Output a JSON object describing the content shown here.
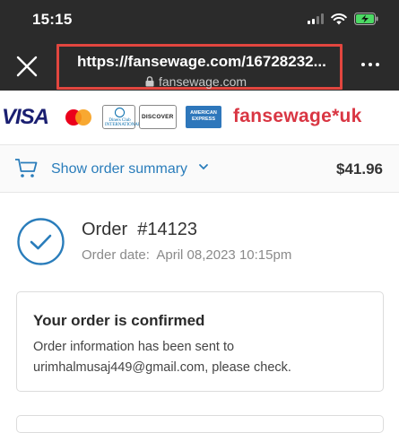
{
  "status_bar": {
    "time": "15:15"
  },
  "browser": {
    "url": "https://fansewage.com/16728232...",
    "domain": "fansewage.com"
  },
  "payment_logos": {
    "visa": "VISA",
    "diners": "Diners Club INTERNATIONAL",
    "discover": "DISCOVER",
    "amex": "AMERICAN EXPRESS",
    "brand": "fansewage*uk"
  },
  "order_summary": {
    "label": "Show order summary",
    "total": "$41.96"
  },
  "order": {
    "title": "Order  #14123",
    "date": "Order date:  April 08,2023 10:15pm"
  },
  "confirmation": {
    "title": "Your order is confirmed",
    "body": "Order information has been sent to urimhalmusaj449@gmail.com, please check."
  },
  "colors": {
    "accent_blue": "#2a7dbb",
    "highlight_red": "#e2463f",
    "brand_red": "#d93643",
    "bar_dark": "#2b2b2b"
  }
}
